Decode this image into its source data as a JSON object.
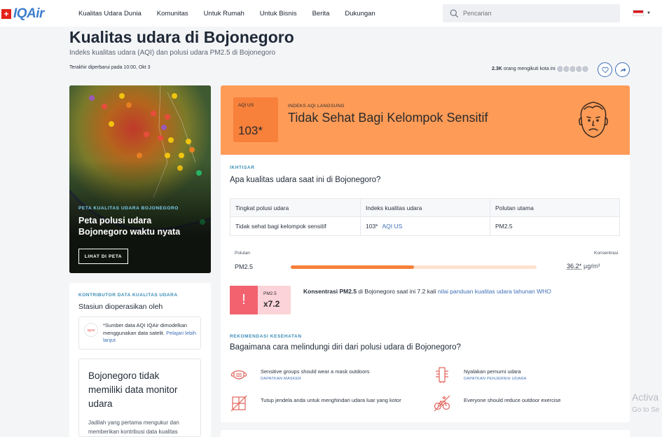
{
  "brand": {
    "name": "IQAir",
    "flag_symbol": "+"
  },
  "nav": {
    "links": [
      "Kualitas Udara Dunia",
      "Komunitas",
      "Untuk Rumah",
      "Untuk Bisnis",
      "Berita",
      "Dukungan"
    ],
    "search_placeholder": "Pencarian",
    "lang_caret": "▼"
  },
  "page": {
    "title": "Kualitas udara di Bojonegoro",
    "subtitle": "Indeks kualitas udara (AQI) dan polusi udara PM2.5 di Bojonegoro",
    "updated": "Terakhir diperbarui pada 10:00, Okt 3",
    "followers_count": "2.3K",
    "followers_text": "orang mengikuti kota ini"
  },
  "map_card": {
    "kicker": "PETA KUALITAS UDARA BOJONEGORO",
    "title": "Peta polusi udara Bojonegoro waktu nyata",
    "button": "LIHAT DI PETA"
  },
  "contributor": {
    "kicker": "KONTRIBUTOR DATA KUALITAS UDARA",
    "operated": "Stasiun dioperasikan oleh",
    "source_logo": "IQAir",
    "source_text": "*Sumber data AQI IQAir dimodelkan menggunakan data satelit.",
    "source_link": "Pelajari lebih lanjut",
    "nodata_title": "Bojonegoro tidak memiliki data monitor udara",
    "nodata_desc": "Jadilah yang pertama mengukur dan memberikan kontribusi data kualitas"
  },
  "aqi": {
    "label": "AQI US",
    "value": "103*",
    "kicker": "INDEKS AQI LANGSUNG",
    "status": "Tidak Sehat Bagi Kelompok Sensitif",
    "band_color": "#fe9b57",
    "box_color": "#f7803b"
  },
  "overview": {
    "kicker": "IKHTISAR",
    "question": "Apa kualitas udara saat ini di Bojonegoro?",
    "table_headers": [
      "Tingkat polusi udara",
      "Indeks kualitas udara",
      "Polutan utama"
    ],
    "row": {
      "level": "Tidak sehat bagi kelompok sensitif",
      "aqi": "103*",
      "aqi_unit": "AQI US",
      "pollutant": "PM2.5"
    }
  },
  "pollutants": {
    "left_label": "Polutan",
    "right_label": "Konsentrasi",
    "items": [
      {
        "name": "PM2.5",
        "value": "36.2*",
        "unit": "µg/m³",
        "fill_fraction": 0.5
      }
    ]
  },
  "warning": {
    "bang": "!",
    "pm_label": "PM2.5",
    "multiplier": "x7.2",
    "conc_bold": "Konsentrasi PM2.5",
    "conc_text": " di Bojonegoro saat ini 7.2 kali ",
    "conc_link": "nilai panduan kualitas udara tahunan WHO"
  },
  "health": {
    "kicker": "REKOMENDASI KESEHATAN",
    "question": "Bagaimana cara melindungi diri dari polusi udara di Bojonegoro?",
    "recs": [
      {
        "text": "Sensitive groups should wear a mask outdoors",
        "link": "DAPATKAN MASKER",
        "icon": "mask-icon"
      },
      {
        "text": "Nyalakan pemurni udara",
        "link": "DAPATKAN PENJERNIH UDARA",
        "icon": "air-purifier-icon"
      },
      {
        "text": "Tutup jendela anda untuk menghindari udara luar yang kotor",
        "link": "",
        "icon": "closed-window-icon"
      },
      {
        "text": "Everyone should reduce outdoor exercise",
        "link": "",
        "icon": "no-cycling-icon"
      }
    ]
  },
  "watermark": {
    "line1": "Activa",
    "line2": "Go to Se"
  }
}
